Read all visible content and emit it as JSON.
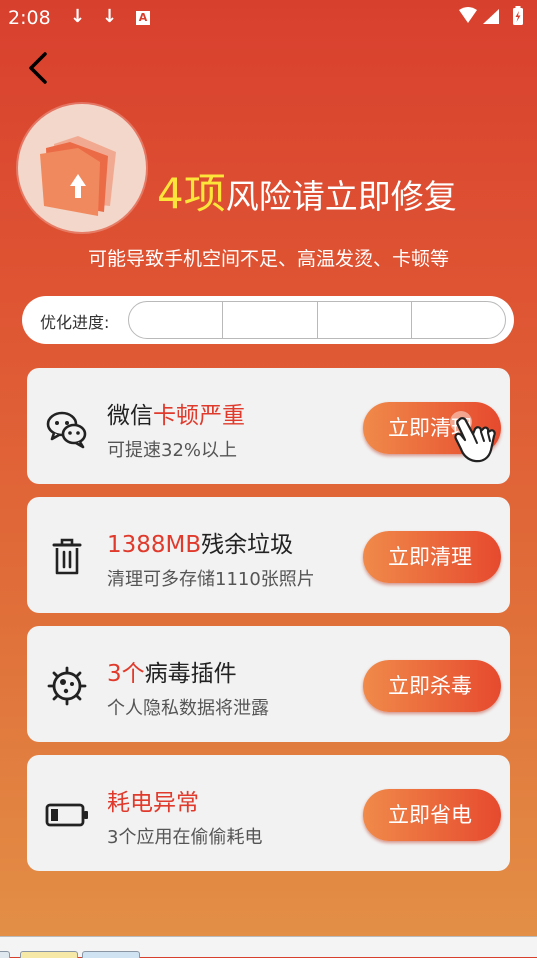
{
  "status_bar": {
    "time": "2:08",
    "download_icon": "↓",
    "notif_icon_letter": "A"
  },
  "header": {
    "risk_count": "4项",
    "title_rest": "风险请立即修复",
    "subtitle": "可能导致手机空间不足、高温发烫、卡顿等"
  },
  "progress": {
    "label": "优化进度:",
    "segments_total": 4,
    "segments_done": 0
  },
  "cards": [
    {
      "icon": "wechat-icon",
      "title_plain": "微信",
      "title_highlight": "卡顿严重",
      "subtitle": "可提速32%以上",
      "button_label": "立即清理"
    },
    {
      "icon": "trash-icon",
      "title_highlight": "1388MB",
      "title_plain": "残余垃圾",
      "subtitle": "清理可多存储1110张照片",
      "button_label": "立即清理"
    },
    {
      "icon": "virus-icon",
      "title_highlight": "3个",
      "title_plain": "病毒插件",
      "subtitle": "个人隐私数据将泄露",
      "button_label": "立即杀毒"
    },
    {
      "icon": "battery-icon",
      "title_highlight": "耗电异常",
      "subtitle": "3个应用在偷偷耗电",
      "button_label": "立即省电"
    }
  ],
  "colors": {
    "highlight_red": "#e03a2c",
    "risk_count_yellow": "#fde53a"
  }
}
